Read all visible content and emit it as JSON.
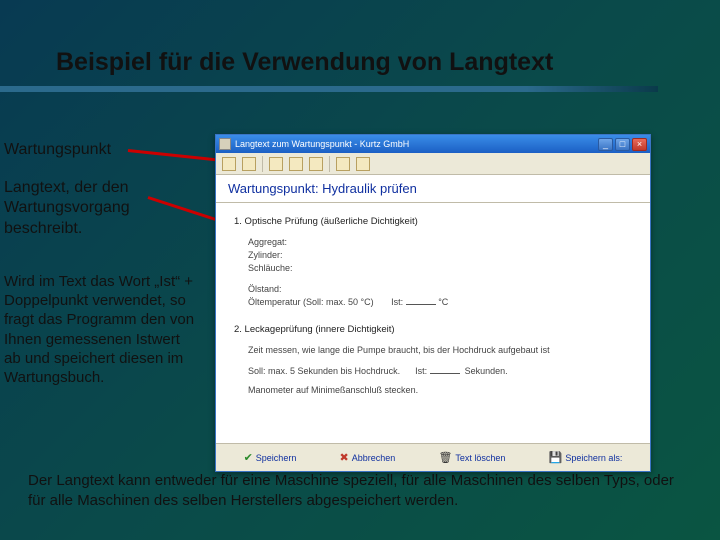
{
  "slide": {
    "title": "Beispiel für die Verwendung von Langtext",
    "label_wartungspunkt": "Wartungspunkt",
    "label_langtext": "Langtext, der den Wartungsvorgang beschreibt.",
    "label_istnote": "Wird im Text das Wort „Ist“ + Doppelpunkt verwendet, so fragt das Programm den von Ihnen gemessenen Istwert ab und speichert diesen im Wartungsbuch.",
    "footnote": "Der Langtext kann entweder für eine Maschine speziell, für alle Maschinen des selben Typs, oder für alle Maschinen des selben Herstellers abgespeichert werden."
  },
  "window": {
    "title": "Langtext zum Wartungspunkt  -  Kurtz GmbH",
    "wp_header": "Wartungspunkt: Hydraulik prüfen",
    "section1_title": "1. Optische Prüfung   (äußerliche Dichtigkeit)",
    "fields": {
      "aggregat": "Aggregat:",
      "zylinder": "Zylinder:",
      "schlauche": "Schläuche:"
    },
    "oelstand": "Ölstand:",
    "oeltemp_label": "Öltemperatur (Soll: max. 50 °C)",
    "ist_label": "Ist:",
    "ist_unit": "°C",
    "section2_title": "2. Leckageprüfung   (innere Dichtigkeit)",
    "leck_line1": "Zeit messen, wie lange die Pumpe braucht, bis der Hochdruck aufgebaut ist",
    "leck_soll": "Soll: max. 5 Sekunden bis Hochdruck.",
    "leck_ist_label": "Ist:",
    "leck_ist_unit": "Sekunden.",
    "manometer": "Manometer auf Minimeßanschluß stecken.",
    "buttons": {
      "save": "Speichern",
      "cancel": "Abbrechen",
      "delete": "Text löschen",
      "saveas": "Speichern als:"
    },
    "controls": {
      "min": "_",
      "max": "□",
      "close": "×"
    }
  }
}
